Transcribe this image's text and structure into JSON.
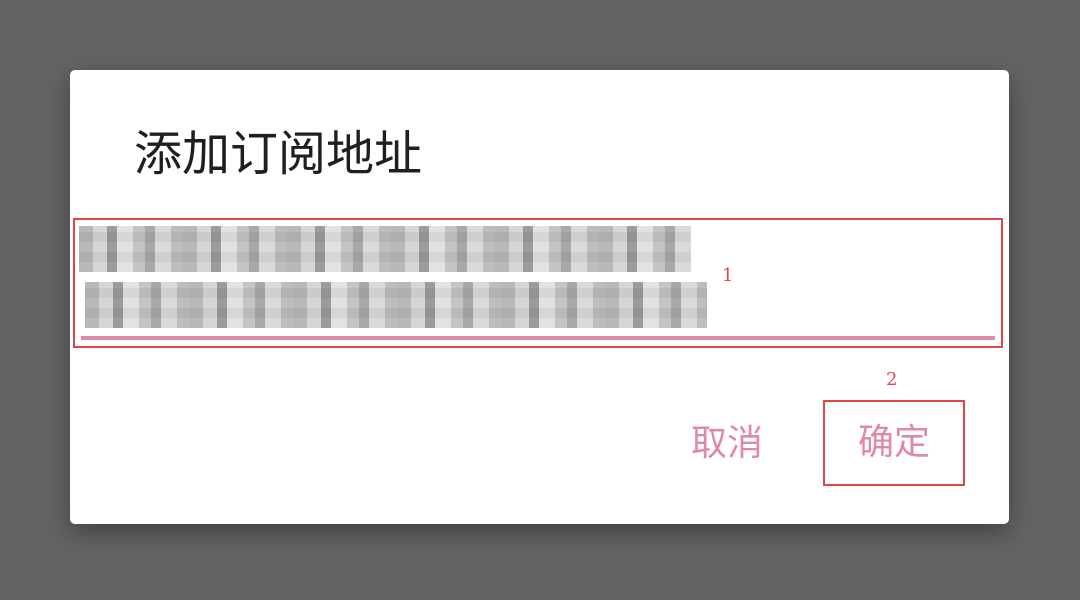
{
  "dialog": {
    "title": "添加订阅地址",
    "url_input": {
      "value": "",
      "redacted": true
    },
    "markers": [
      "1",
      "2"
    ],
    "buttons": {
      "cancel_label": "取消",
      "ok_label": "确定"
    }
  },
  "colors": {
    "overlay_background": "#636363",
    "accent_pink": "#e088aa",
    "annotation_red": "#e14545",
    "title_text": "#1f1f1f"
  }
}
